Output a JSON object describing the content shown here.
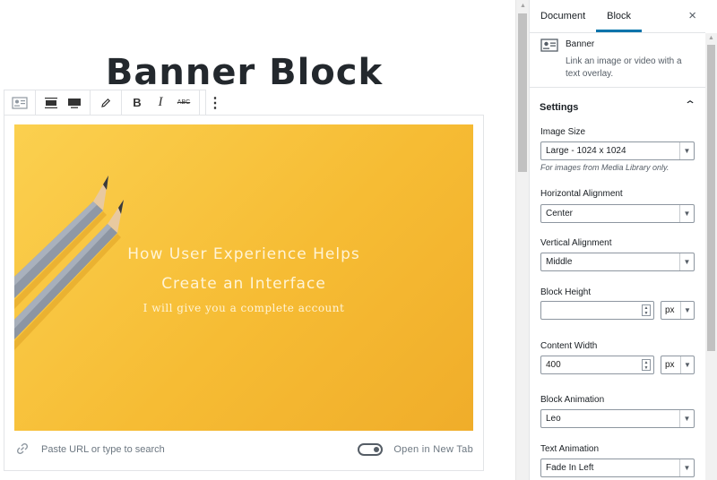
{
  "editor": {
    "post_title": "Banner Block",
    "toolbar": {
      "block_type_icon": "banner-block-icon",
      "align_wide_icon": "align-wide-icon",
      "align_full_icon": "align-full-icon",
      "edit_icon": "pencil-icon",
      "bold_label": "B",
      "italic_label": "I",
      "strike_label": "ABC",
      "more_label": "⋮"
    },
    "banner": {
      "line1": "How User Experience Helps",
      "line2": "Create an Interface",
      "subtitle": "I will give you a complete account",
      "background_color": "#f6bc34"
    },
    "url_row": {
      "link_icon": "link-icon",
      "placeholder": "Paste URL or type to search",
      "new_tab_label": "Open in New Tab"
    }
  },
  "sidebar": {
    "tabs": [
      {
        "label": "Document",
        "active": false
      },
      {
        "label": "Block",
        "active": true
      }
    ],
    "close_label": "×",
    "block_card": {
      "icon": "banner-block-icon",
      "title": "Banner",
      "description": "Link an image or video with a text overlay."
    },
    "settings": {
      "title": "Settings",
      "chevron": "⌃",
      "image_size": {
        "label": "Image Size",
        "value": "Large - 1024 x 1024",
        "hint": "For images from Media Library only."
      },
      "horizontal_alignment": {
        "label": "Horizontal Alignment",
        "value": "Center"
      },
      "vertical_alignment": {
        "label": "Vertical Alignment",
        "value": "Middle"
      },
      "block_height": {
        "label": "Block Height",
        "value": "",
        "unit": "px"
      },
      "content_width": {
        "label": "Content Width",
        "value": "400",
        "unit": "px"
      },
      "block_animation": {
        "label": "Block Animation",
        "value": "Leo"
      },
      "text_animation": {
        "label": "Text Animation",
        "value": "Fade In Left"
      }
    }
  },
  "colors": {
    "accent": "#0073aa",
    "border": "#e2e4e7"
  }
}
